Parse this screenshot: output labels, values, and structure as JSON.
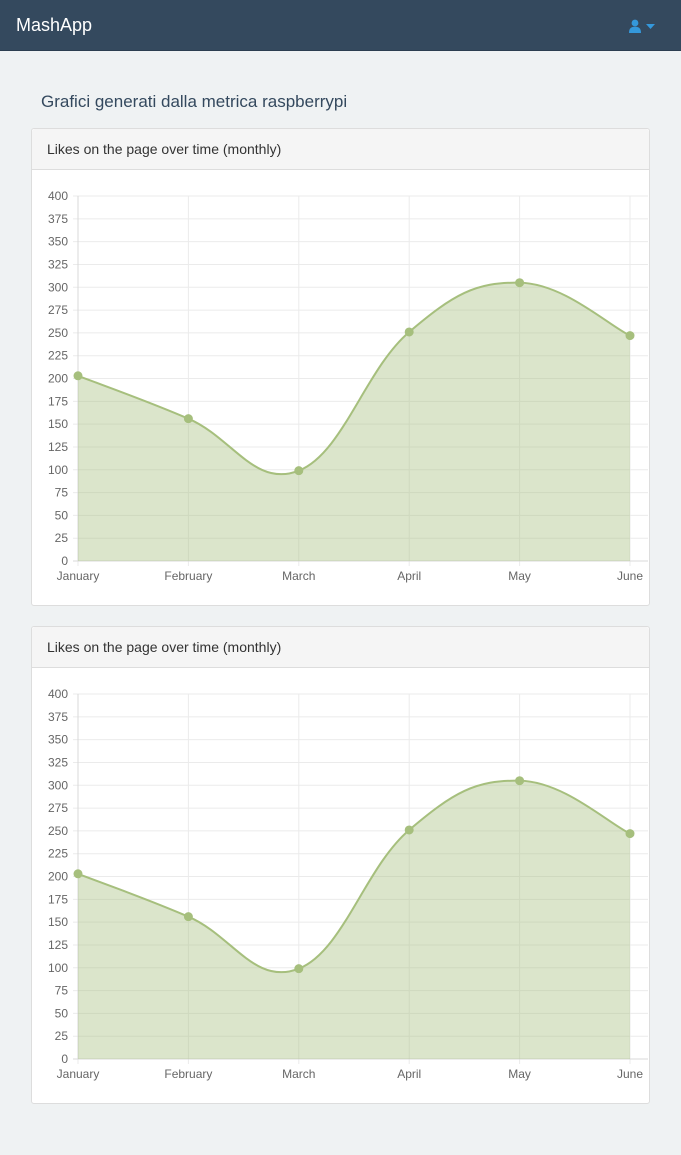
{
  "navbar": {
    "brand": "MashApp",
    "user_icon": "user-icon",
    "caret_icon": "caret-down-icon",
    "color": "#34495e",
    "icon_color": "#3498db"
  },
  "page": {
    "heading": "Grafici generati dalla metrica raspberrypi"
  },
  "panels": [
    {
      "title": "Likes on the page over time (monthly)"
    },
    {
      "title": "Likes on the page over time (monthly)"
    }
  ],
  "chart_data": [
    {
      "type": "area",
      "categories": [
        "January",
        "February",
        "March",
        "April",
        "May",
        "June"
      ],
      "series": [
        {
          "values": [
            203,
            156,
            99,
            251,
            305,
            247
          ],
          "color": "#a6bf7d",
          "fill": "rgba(166,191,125,0.4)"
        }
      ],
      "ylim": [
        0,
        400
      ],
      "yticks": [
        "0",
        "25",
        "50",
        "75",
        "100",
        "125",
        "150",
        "175",
        "200",
        "225",
        "250",
        "275",
        "300",
        "325",
        "350",
        "375",
        "400"
      ],
      "grid": true,
      "legend": "none"
    },
    {
      "type": "area",
      "categories": [
        "January",
        "February",
        "March",
        "April",
        "May",
        "June"
      ],
      "series": [
        {
          "values": [
            203,
            156,
            99,
            251,
            305,
            247
          ],
          "color": "#a6bf7d",
          "fill": "rgba(166,191,125,0.4)"
        }
      ],
      "ylim": [
        0,
        400
      ],
      "yticks": [
        "0",
        "25",
        "50",
        "75",
        "100",
        "125",
        "150",
        "175",
        "200",
        "225",
        "250",
        "275",
        "300",
        "325",
        "350",
        "375",
        "400"
      ],
      "grid": true,
      "legend": "none"
    }
  ]
}
